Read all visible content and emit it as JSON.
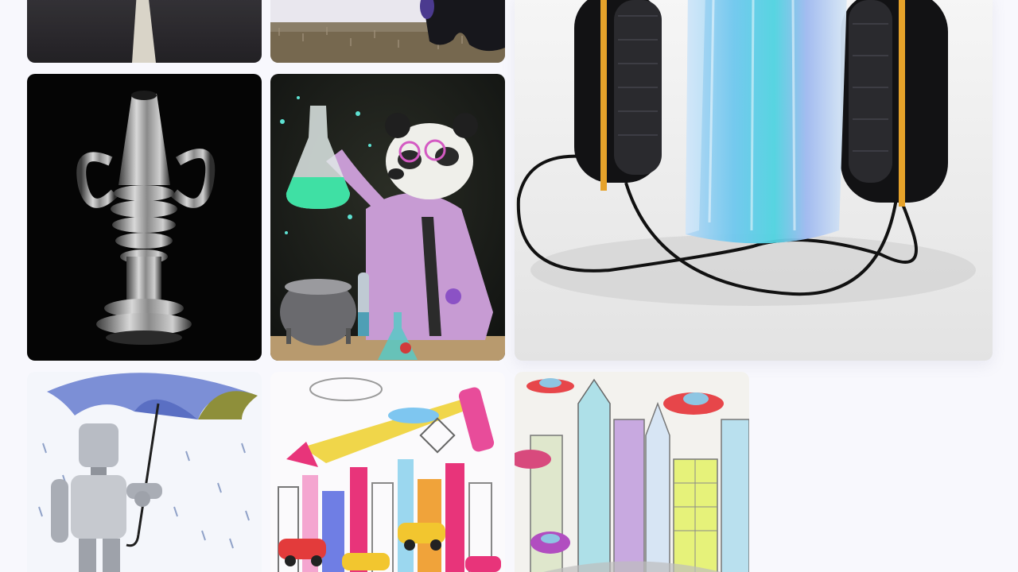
{
  "gallery": {
    "tiles": [
      {
        "id": "road",
        "subject": "road-with-lane-marking"
      },
      {
        "id": "grass",
        "subject": "grass-with-dark-object"
      },
      {
        "id": "headphone",
        "subject": "headphones-with-holographic-mask"
      },
      {
        "id": "silver",
        "subject": "silver-ornament-sculpture"
      },
      {
        "id": "panda",
        "subject": "panda-scientist-with-flask"
      },
      {
        "id": "robot",
        "subject": "robot-with-umbrella-in-rain"
      },
      {
        "id": "city1",
        "subject": "drawn-city-with-flying-cars"
      },
      {
        "id": "city2",
        "subject": "sketched-skyscrapers-with-flying-saucers"
      }
    ]
  },
  "colors": {
    "page_background": "#f8f8fd",
    "panda_coat": "#c79bd3",
    "flask_liquid": "#3fe0a4",
    "headphone_accent": "#e6a22a"
  }
}
